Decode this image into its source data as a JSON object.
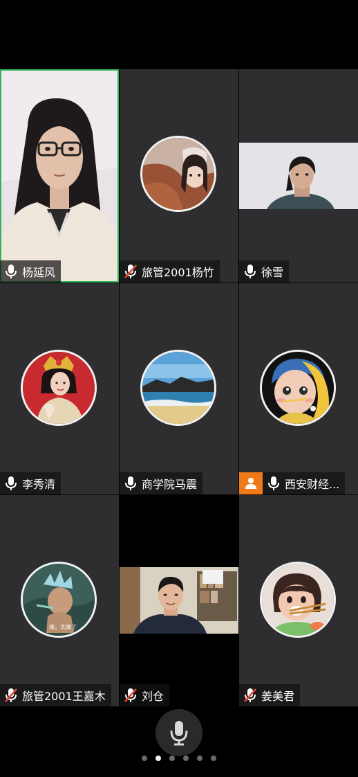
{
  "participants": [
    {
      "name": "杨延风",
      "mic": "on",
      "speaking": true
    },
    {
      "name": "旅管2001杨竹",
      "mic": "muted"
    },
    {
      "name": "徐雪",
      "mic": "on"
    },
    {
      "name": "李秀清",
      "mic": "on"
    },
    {
      "name": "商学院马震",
      "mic": "on"
    },
    {
      "name": "西安财经...",
      "mic": "on",
      "host": true
    },
    {
      "name": "旅管2001王嘉木",
      "mic": "muted"
    },
    {
      "name": "刘仓",
      "mic": "muted"
    },
    {
      "name": "姜美君",
      "mic": "muted"
    }
  ],
  "avatar_overlay_text": "痛，太痛了",
  "pager": {
    "total": 6,
    "current": 2
  },
  "colors": {
    "tile_bg": "#2e2e30",
    "speaking_border": "#2fb45a",
    "host_badge": "#f07a1a",
    "muted_slash": "#e5483a"
  },
  "icons": {
    "mic": "microphone-icon",
    "mic_muted": "microphone-muted-icon",
    "host": "person-icon",
    "bottom_control": "microphone-icon"
  }
}
